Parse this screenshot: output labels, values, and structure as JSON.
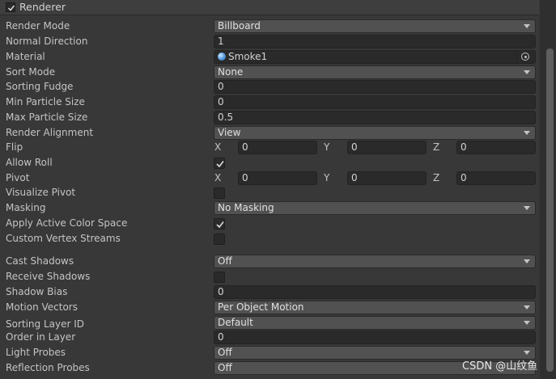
{
  "header": {
    "title": "Renderer",
    "enabled": true
  },
  "rows": {
    "render_mode": {
      "label": "Render Mode",
      "value": "Billboard"
    },
    "normal_direction": {
      "label": "Normal Direction",
      "value": "1"
    },
    "material": {
      "label": "Material",
      "value": "Smoke1"
    },
    "sort_mode": {
      "label": "Sort Mode",
      "value": "None"
    },
    "sorting_fudge": {
      "label": "Sorting Fudge",
      "value": "0"
    },
    "min_particle_size": {
      "label": "Min Particle Size",
      "value": "0"
    },
    "max_particle_size": {
      "label": "Max Particle Size",
      "value": "0.5"
    },
    "render_alignment": {
      "label": "Render Alignment",
      "value": "View"
    },
    "flip": {
      "label": "Flip",
      "x_label": "X",
      "x": "0",
      "y_label": "Y",
      "y": "0",
      "z_label": "Z",
      "z": "0"
    },
    "allow_roll": {
      "label": "Allow Roll",
      "checked": true
    },
    "pivot": {
      "label": "Pivot",
      "x_label": "X",
      "x": "0",
      "y_label": "Y",
      "y": "0",
      "z_label": "Z",
      "z": "0"
    },
    "visualize_pivot": {
      "label": "Visualize Pivot",
      "checked": false
    },
    "masking": {
      "label": "Masking",
      "value": "No Masking"
    },
    "apply_active_color_space": {
      "label": "Apply Active Color Space",
      "checked": true
    },
    "custom_vertex_streams": {
      "label": "Custom Vertex Streams",
      "checked": false
    },
    "cast_shadows": {
      "label": "Cast Shadows",
      "value": "Off"
    },
    "receive_shadows": {
      "label": "Receive Shadows",
      "checked": false
    },
    "shadow_bias": {
      "label": "Shadow Bias",
      "value": "0"
    },
    "motion_vectors": {
      "label": "Motion Vectors",
      "value": "Per Object Motion"
    },
    "sorting_layer_id": {
      "label": "Sorting Layer ID",
      "value": "Default"
    },
    "order_in_layer": {
      "label": "Order in Layer",
      "value": "0"
    },
    "light_probes": {
      "label": "Light Probes",
      "value": "Off"
    },
    "reflection_probes": {
      "label": "Reflection Probes",
      "value": "Off"
    }
  },
  "watermark": "CSDN @山纹鱼"
}
